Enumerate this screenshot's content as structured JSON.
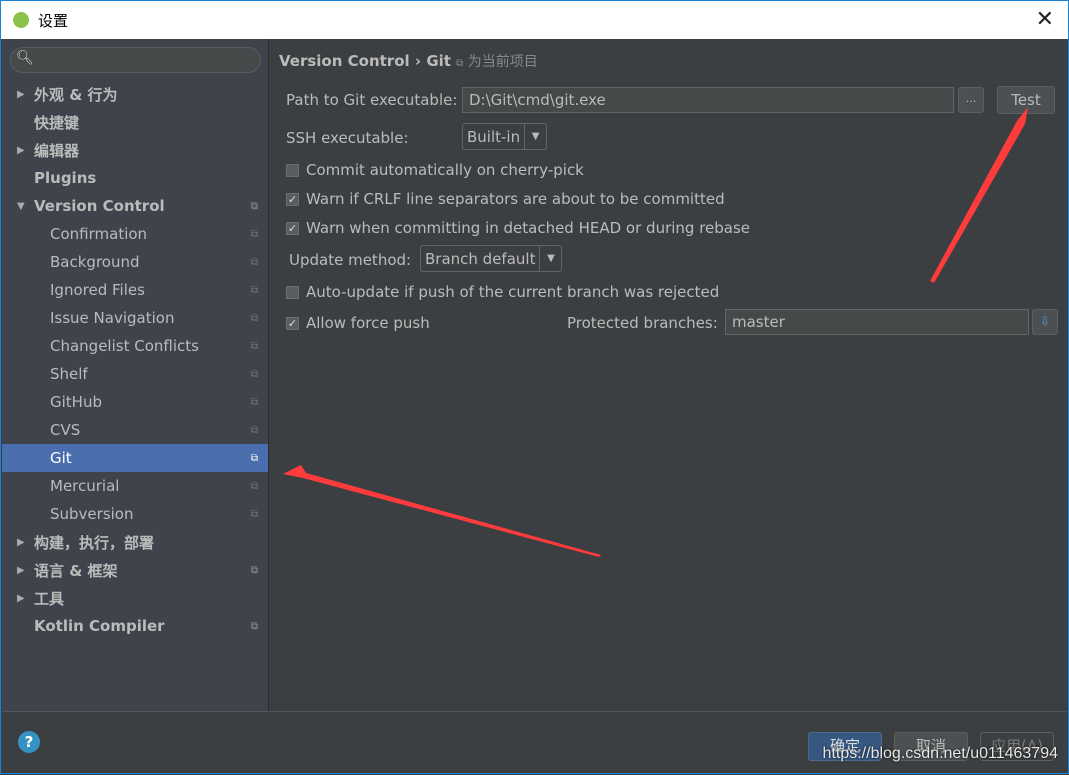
{
  "window": {
    "title": "设置",
    "close_icon": "close-icon"
  },
  "search": {
    "placeholder": ""
  },
  "sidebar": {
    "items": [
      {
        "label": "外观 & 行为",
        "level": 1,
        "arrow": "right",
        "bold": true,
        "copy": false
      },
      {
        "label": "快捷键",
        "level": 1,
        "bold": true,
        "copy": false
      },
      {
        "label": "编辑器",
        "level": 1,
        "arrow": "right",
        "bold": true,
        "copy": false
      },
      {
        "label": "Plugins",
        "level": 1,
        "bold": true,
        "copy": false
      },
      {
        "label": "Version Control",
        "level": 1,
        "arrow": "down",
        "bold": true,
        "copy": true
      },
      {
        "label": "Confirmation",
        "level": 2,
        "copy": true
      },
      {
        "label": "Background",
        "level": 2,
        "copy": true
      },
      {
        "label": "Ignored Files",
        "level": 2,
        "copy": true
      },
      {
        "label": "Issue Navigation",
        "level": 2,
        "copy": true
      },
      {
        "label": "Changelist Conflicts",
        "level": 2,
        "copy": true
      },
      {
        "label": "Shelf",
        "level": 2,
        "copy": true
      },
      {
        "label": "GitHub",
        "level": 2,
        "copy": true
      },
      {
        "label": "CVS",
        "level": 2,
        "copy": true
      },
      {
        "label": "Git",
        "level": 2,
        "copy": true,
        "selected": true
      },
      {
        "label": "Mercurial",
        "level": 2,
        "copy": true
      },
      {
        "label": "Subversion",
        "level": 2,
        "copy": true
      },
      {
        "label": "构建，执行，部署",
        "level": 1,
        "arrow": "right",
        "bold": true,
        "copy": false
      },
      {
        "label": "语言 & 框架",
        "level": 1,
        "arrow": "right",
        "bold": true,
        "copy": true
      },
      {
        "label": "工具",
        "level": 1,
        "arrow": "right",
        "bold": true,
        "copy": false
      },
      {
        "label": "Kotlin Compiler",
        "level": 1,
        "bold": true,
        "copy": true
      }
    ]
  },
  "main": {
    "breadcrumb": {
      "parent": "Version Control",
      "sep": "›",
      "current": "Git",
      "project_note": "为当前项目"
    },
    "path_label": "Path to Git executable:",
    "path_value": "D:\\Git\\cmd\\git.exe",
    "browse_label": "...",
    "test_label": "Test",
    "ssh_label": "SSH executable:",
    "ssh_value": "Built-in",
    "checks": [
      {
        "label": "Commit automatically on cherry-pick",
        "checked": false
      },
      {
        "label": "Warn if CRLF line separators are about to be committed",
        "checked": true
      },
      {
        "label": "Warn when committing in detached HEAD or during rebase",
        "checked": true
      }
    ],
    "update_label": "Update method:",
    "update_value": "Branch default",
    "auto_update": {
      "label": "Auto-update if push of the current branch was rejected",
      "checked": false
    },
    "force_push": {
      "label": "Allow force push",
      "checked": true
    },
    "protected_label": "Protected branches:",
    "protected_value": "master"
  },
  "footer": {
    "help": "?",
    "ok": "确定",
    "cancel": "取消",
    "apply": "应用(A)"
  },
  "watermark": "https://blog.csdn.net/u011463794",
  "colors": {
    "selection": "#4b6eaf",
    "annotation_arrow": "#ff3b3b"
  }
}
